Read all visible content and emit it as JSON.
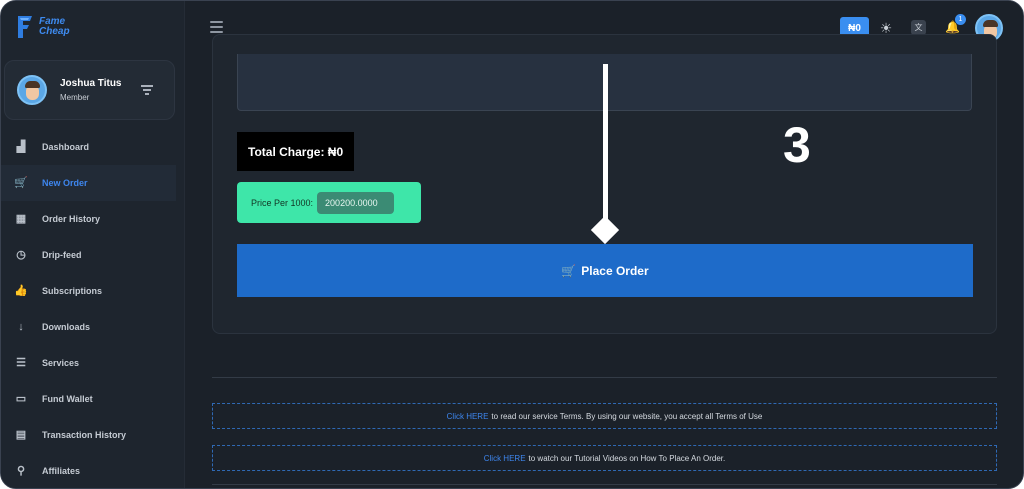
{
  "brand": {
    "line1": "Fame",
    "line2": "Cheap",
    "accent": "#3e8bf0"
  },
  "profile": {
    "name": "Joshua Titus",
    "role": "Member"
  },
  "sidebar": {
    "items": [
      {
        "label": "Dashboard",
        "icon": "chart-icon",
        "active": false
      },
      {
        "label": "New Order",
        "icon": "cart-icon",
        "active": true
      },
      {
        "label": "Order History",
        "icon": "calendar-icon",
        "active": false
      },
      {
        "label": "Drip-feed",
        "icon": "clock-icon",
        "active": false
      },
      {
        "label": "Subscriptions",
        "icon": "thumbs-up-icon",
        "active": false
      },
      {
        "label": "Downloads",
        "icon": "arrow-down-icon",
        "active": false
      },
      {
        "label": "Services",
        "icon": "list-icon",
        "active": false
      },
      {
        "label": "Fund Wallet",
        "icon": "wallet-icon",
        "active": false
      },
      {
        "label": "Transaction History",
        "icon": "receipt-icon",
        "active": false
      },
      {
        "label": "Affiliates",
        "icon": "users-icon",
        "active": false
      }
    ]
  },
  "topbar": {
    "balance": "₦0",
    "notification_count": "1",
    "translate_glyph": "文"
  },
  "order": {
    "total_charge_label": "Total Charge: ₦0",
    "price_per_label": "Price Per 1000:",
    "price_per_value": "200200.0000",
    "place_order_label": "Place Order",
    "step_number": "3"
  },
  "notices": [
    {
      "link": "Click HERE",
      "text": "to read our service Terms. By using our website, you accept all Terms of Use"
    },
    {
      "link": "Click HERE",
      "text": "to watch our Tutorial Videos on How To Place An Order."
    }
  ],
  "colors": {
    "primary": "#1e6bc9",
    "price_box": "#3ee6a9",
    "background": "#1b2129"
  }
}
